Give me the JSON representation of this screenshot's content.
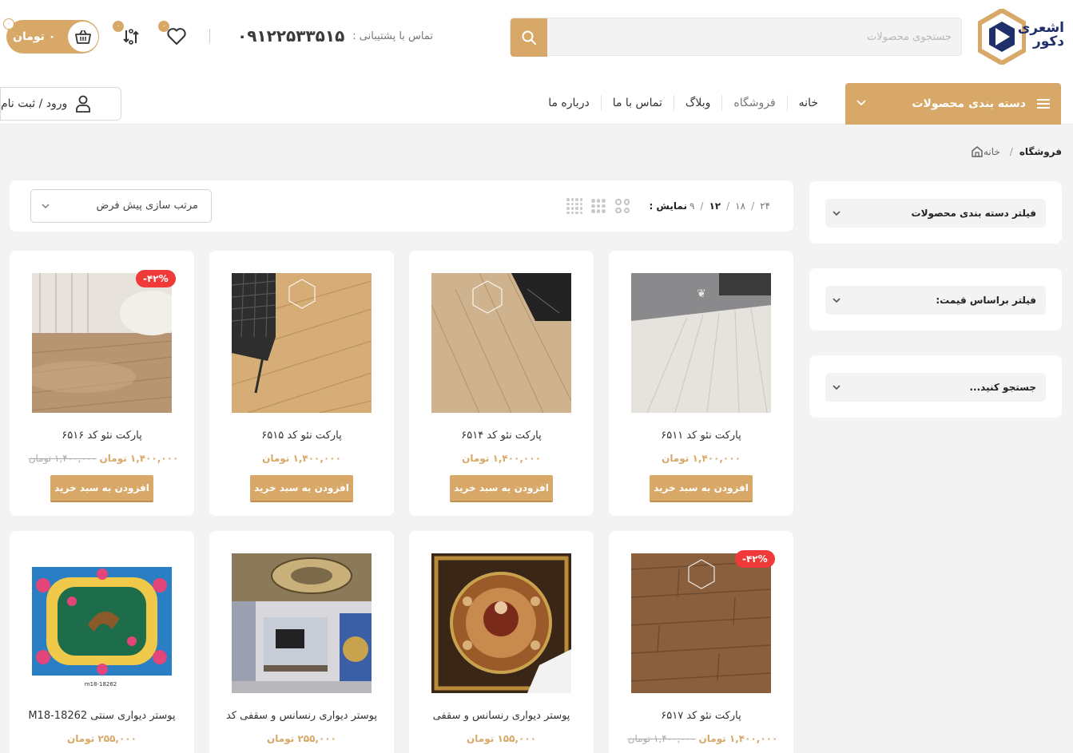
{
  "header": {
    "logo_text_line1": "اشعری",
    "logo_text_line2": "دکور",
    "search_placeholder": "جستجوی محصولات",
    "support_label": "تماس با پشتیبانی :",
    "support_phone": "۰۹۱۲۲۵۳۳۵۱۵",
    "compare_count": "۰",
    "wishlist_count": "۰",
    "cart_count": "۰",
    "cart_total": "۰ تومان"
  },
  "nav": {
    "category_button": "دسته بندی محصولات",
    "items": [
      {
        "label": "خانه"
      },
      {
        "label": "فروشگاه"
      },
      {
        "label": "وبلاگ"
      },
      {
        "label": "تماس با ما"
      },
      {
        "label": "درباره ما"
      }
    ],
    "login": "ورود / ثبت نام"
  },
  "breadcrumb": {
    "home": "خانه",
    "separator": "/",
    "current": "فروشگاه"
  },
  "sidebar": {
    "filters": [
      {
        "title": "فیلتر دسته بندی محصولات"
      },
      {
        "title": "فیلتر براساس قیمت:"
      },
      {
        "title": "جستجو کنید..."
      }
    ]
  },
  "toolbar": {
    "show_label": "نمایش :",
    "counts": [
      "۹",
      "۱۲",
      "۱۸",
      "۲۴"
    ],
    "active_count": "۱۲",
    "sort_label": "مرتب سازی پیش فرض"
  },
  "products": [
    {
      "name": "پارکت نئو کد ۶۵۱۱",
      "price": "۱,۴۰۰,۰۰۰ تومان",
      "old_price": "",
      "discount": "",
      "button": "افزودن به سبد خرید",
      "image": "light-grey-laminate-floor"
    },
    {
      "name": "پارکت نئو کد ۶۵۱۴",
      "price": "۱,۴۰۰,۰۰۰ تومان",
      "old_price": "",
      "discount": "",
      "button": "افزودن به سبد خرید",
      "image": "beige-laminate-floor"
    },
    {
      "name": "پارکت نئو کد ۶۵۱۵",
      "price": "۱,۴۰۰,۰۰۰ تومان",
      "old_price": "",
      "discount": "",
      "button": "افزودن به سبد خرید",
      "image": "oak-laminate-floor-chair"
    },
    {
      "name": "پارکت نئو کد ۶۵۱۶",
      "price": "۱,۴۰۰,۰۰۰ تومان",
      "old_price": "۱,۴۰۰,۰۰۰ تومان",
      "discount": "-۴۲%",
      "button": "افزودن به سبد خرید",
      "image": "wood-floor-room"
    },
    {
      "name": "پارکت نئو کد ۶۵۱۷",
      "price": "۱,۴۰۰,۰۰۰ تومان",
      "old_price": "۱,۴۰۰,۰۰۰ تومان",
      "discount": "-۴۲%",
      "button": "افزودن به سبد خرید",
      "image": "brown-laminate-floor"
    },
    {
      "name": "پوستر دیواری رنسانس و سقفی",
      "price": "۱۵۵,۰۰۰ تومان",
      "old_price": "",
      "discount": "",
      "button": "",
      "image": "renaissance-ceiling-painting"
    },
    {
      "name": "پوستر دیواری رنسانس و سقفی کد",
      "price": "۲۵۵,۰۰۰ تومان",
      "old_price": "",
      "discount": "",
      "button": "",
      "image": "living-room-ceiling-mural"
    },
    {
      "name": "پوستر دیواری سنتی M18-18262",
      "price": "۲۵۵,۰۰۰ تومان",
      "old_price": "",
      "discount": "",
      "button": "",
      "image": "persian-tile-mural",
      "image_code": "m18-18262"
    }
  ],
  "colors": {
    "accent": "#d7a867",
    "discount": "#f03a3a",
    "background": "#f3f3f3",
    "logo_blue": "#1f2f6b"
  }
}
